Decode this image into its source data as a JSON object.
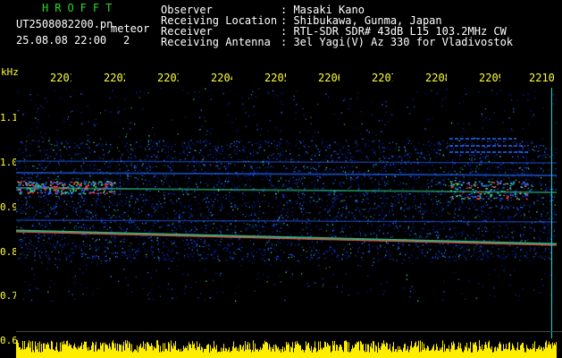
{
  "header": {
    "brand": "HROFFT",
    "file_name": "UT2508082200.pn",
    "tag": "meteor",
    "date_time": "25.08.08 22:00",
    "page_no": "2",
    "fields": [
      {
        "label": "Observer",
        "value": ": Masaki Kano"
      },
      {
        "label": "Receiving Location",
        "value": ": Shibukawa, Gunma, Japan"
      },
      {
        "label": "Receiver",
        "value": ": RTL-SDR SDR# 43dB L15 103.2MHz CW"
      },
      {
        "label": "Receiving Antenna",
        "value": ": 3el Yagi(V) Az 330 for Vladivostok"
      }
    ]
  },
  "spectrogram": {
    "unit": "kHz",
    "y_ticks": [
      "1.1",
      "1.0",
      "0.9",
      "0.8",
      "0.7",
      "0.6"
    ],
    "x_ticks": [
      "2201",
      "2202",
      "2203",
      "2204",
      "2205",
      "2206",
      "2207",
      "2208",
      "2209",
      "2210"
    ],
    "colors": {
      "background": "#000000",
      "weak": "#0022aa",
      "medium": "#2266ff",
      "strong": "#33cc88",
      "peak": "#ff3333",
      "label": "#ffff33",
      "brand": "#22dd22",
      "noise": "#ffee00"
    }
  }
}
